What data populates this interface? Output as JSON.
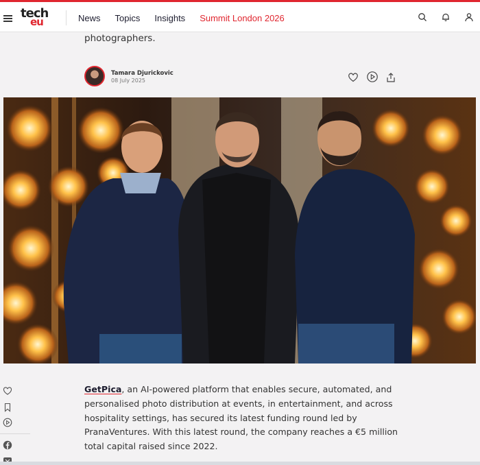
{
  "header": {
    "logo_top": "tech",
    "logo_bottom": "eu",
    "nav": [
      {
        "label": "News"
      },
      {
        "label": "Topics"
      },
      {
        "label": "Insights"
      },
      {
        "label": "Summit London 2026"
      }
    ],
    "accent_color": "#e0262f"
  },
  "article": {
    "intro_tail": "photographers.",
    "author_name": "Tamara Djurickovic",
    "date": "08 July 2025",
    "body_link": "GetPica",
    "body_text": ", an AI-powered platform that enables secure, automated, and personalised photo distribution at events, in entertainment, and across hospitality settings, has secured its latest funding round led by PranaVentures. With this latest round, the company reaches a €5 million total capital raised since 2022."
  },
  "icons": {
    "header": [
      "search-icon",
      "bell-icon",
      "user-icon"
    ],
    "article_actions": [
      "heart-icon",
      "play-icon",
      "share-icon"
    ],
    "side": [
      "heart-icon",
      "bookmark-icon",
      "play-icon",
      "facebook-icon",
      "x-icon"
    ]
  }
}
